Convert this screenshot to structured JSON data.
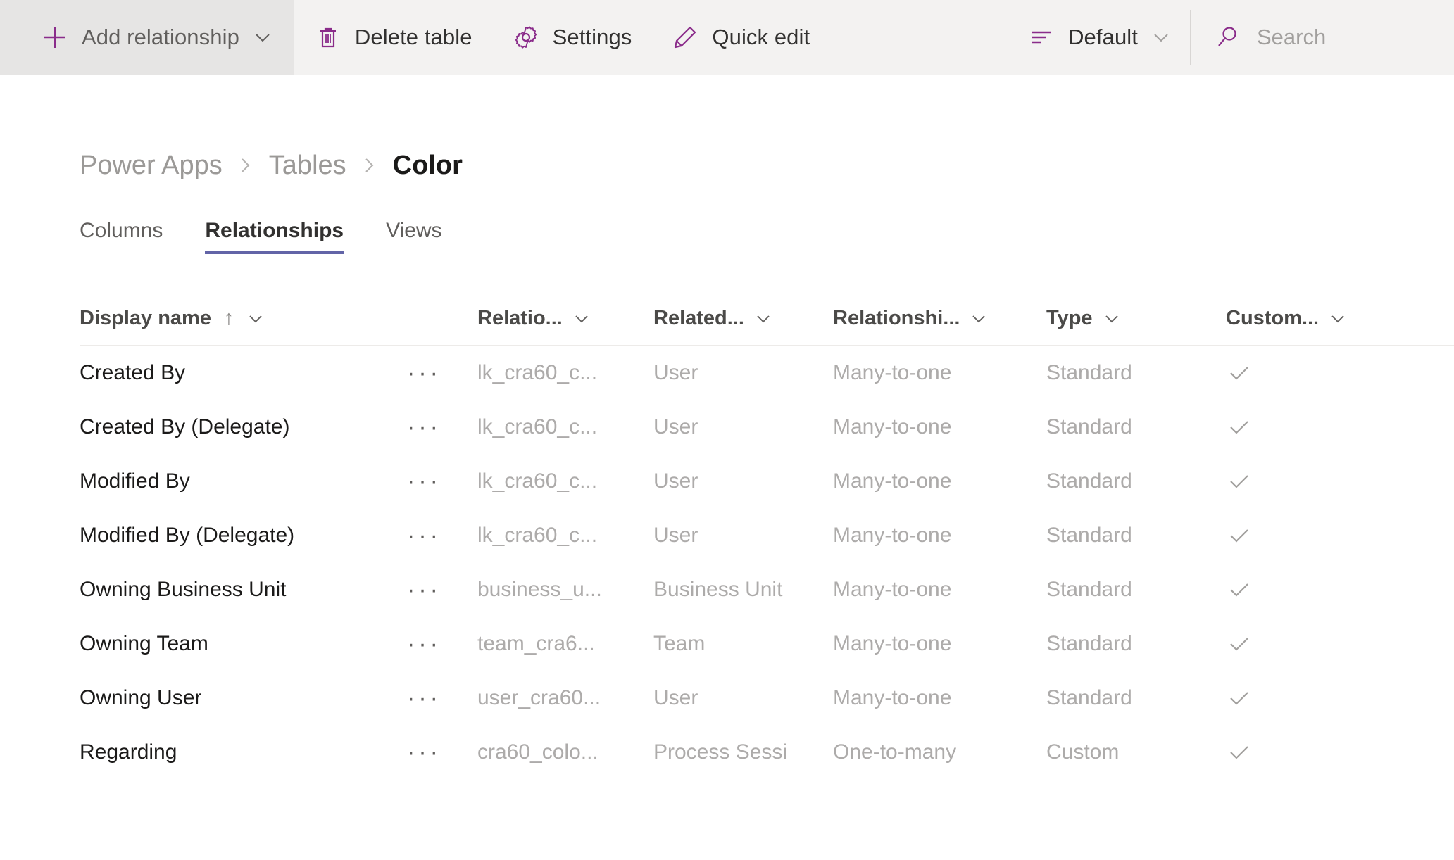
{
  "toolbar": {
    "add_relationship": {
      "label": "Add relationship",
      "icon": "plus-icon",
      "has_chevron": true,
      "highlighted": true
    },
    "delete_table": {
      "label": "Delete table",
      "icon": "trash-icon"
    },
    "settings": {
      "label": "Settings",
      "icon": "gear-icon"
    },
    "quick_edit": {
      "label": "Quick edit",
      "icon": "pencil-icon"
    },
    "view_picker": {
      "label": "Default",
      "icon": "view-list-icon",
      "has_chevron": true
    },
    "search": {
      "placeholder": "Search",
      "value": "",
      "icon": "search-icon"
    }
  },
  "breadcrumb": {
    "items": [
      {
        "label": "Power Apps",
        "current": false
      },
      {
        "label": "Tables",
        "current": false
      },
      {
        "label": "Color",
        "current": true
      }
    ],
    "separator": "chevron-right-icon"
  },
  "tabs": [
    {
      "label": "Columns",
      "active": false
    },
    {
      "label": "Relationships",
      "active": true
    },
    {
      "label": "Views",
      "active": false
    }
  ],
  "grid": {
    "columns": [
      {
        "label": "Display name",
        "sorted": "asc",
        "sort_glyph": "↑",
        "has_chevron": true
      },
      {
        "label": "Relatio...",
        "has_chevron": true
      },
      {
        "label": "Related...",
        "has_chevron": true
      },
      {
        "label": "Relationshi...",
        "has_chevron": true
      },
      {
        "label": "Type",
        "has_chevron": true
      },
      {
        "label": "Custom...",
        "has_chevron": true
      }
    ],
    "row_menu_glyph": "···",
    "custom_check_glyph": "check-icon",
    "rows": [
      {
        "display_name": "Created By",
        "relationship_name": "lk_cra60_c...",
        "related_table": "User",
        "relationship_type": "Many-to-one",
        "type": "Standard",
        "custom": true
      },
      {
        "display_name": "Created By (Delegate)",
        "relationship_name": "lk_cra60_c...",
        "related_table": "User",
        "relationship_type": "Many-to-one",
        "type": "Standard",
        "custom": true
      },
      {
        "display_name": "Modified By",
        "relationship_name": "lk_cra60_c...",
        "related_table": "User",
        "relationship_type": "Many-to-one",
        "type": "Standard",
        "custom": true
      },
      {
        "display_name": "Modified By (Delegate)",
        "relationship_name": "lk_cra60_c...",
        "related_table": "User",
        "relationship_type": "Many-to-one",
        "type": "Standard",
        "custom": true
      },
      {
        "display_name": "Owning Business Unit",
        "relationship_name": "business_u...",
        "related_table": "Business Unit",
        "relationship_type": "Many-to-one",
        "type": "Standard",
        "custom": true
      },
      {
        "display_name": "Owning Team",
        "relationship_name": "team_cra6...",
        "related_table": "Team",
        "relationship_type": "Many-to-one",
        "type": "Standard",
        "custom": true
      },
      {
        "display_name": "Owning User",
        "relationship_name": "user_cra60...",
        "related_table": "User",
        "relationship_type": "Many-to-one",
        "type": "Standard",
        "custom": true
      },
      {
        "display_name": "Regarding",
        "relationship_name": "cra60_colo...",
        "related_table": "Process Sessi",
        "relationship_type": "One-to-many",
        "type": "Custom",
        "custom": true
      }
    ]
  },
  "colors": {
    "accent_purple": "#8a2c8a",
    "tab_underline": "#6264a7",
    "toolbar_bg": "#f3f2f1",
    "toolbar_highlight_bg": "#e6e5e4",
    "text_primary": "#1b1a19",
    "text_secondary": "#adabaa"
  }
}
